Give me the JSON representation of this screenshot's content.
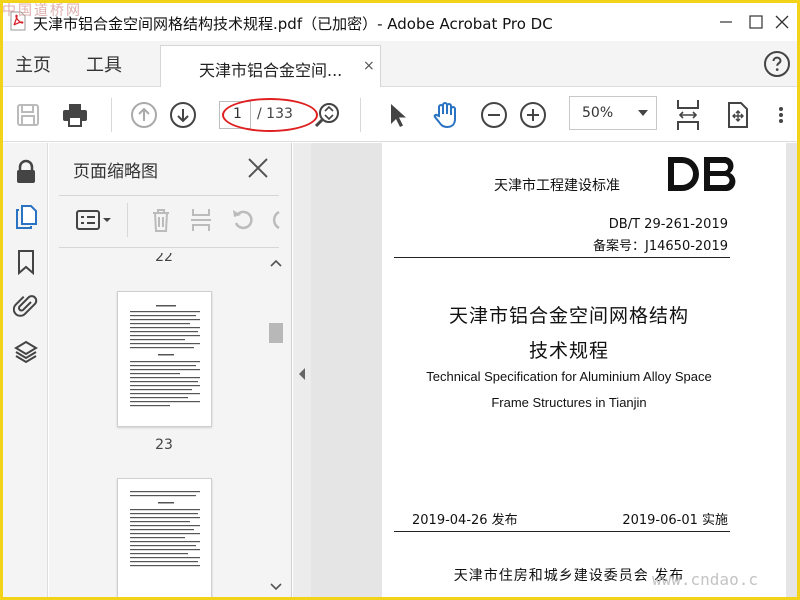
{
  "window": {
    "title": "天津市铝合金空间网格结构技术规程.pdf（已加密）- Adobe Acrobat Pro DC",
    "watermark_top": "中国道桥网",
    "watermark_bottom": "www.cndao.c"
  },
  "menu": {
    "home": "主页",
    "tools": "工具",
    "tab_label": "天津市铝合金空间...",
    "tab_close": "×"
  },
  "toolbar": {
    "current_page": "1",
    "total_pages": "/ 133",
    "zoom": "50%"
  },
  "panel": {
    "title": "页面缩略图",
    "thumbnails": [
      {
        "label": "22"
      },
      {
        "label": "23"
      }
    ]
  },
  "document": {
    "standard": "天津市工程建设标准",
    "logo": "DB",
    "code": "DB/T 29-261-2019",
    "record_no": "备案号：J14650-2019",
    "title_line1": "天津市铝合金空间网格结构",
    "title_line2": "技术规程",
    "title_en_line1": "Technical Specification for Aluminium Alloy Space",
    "title_en_line2": "Frame Structures in Tianjin",
    "issue_date": "2019-04-26 发布",
    "impl_date": "2019-06-01 实施",
    "publisher": "天津市住房和城乡建设委员会 发布"
  },
  "colors": {
    "accent_blue": "#2a73c2",
    "highlight_red": "#e02020",
    "frame_yellow": "#f2d31a"
  }
}
